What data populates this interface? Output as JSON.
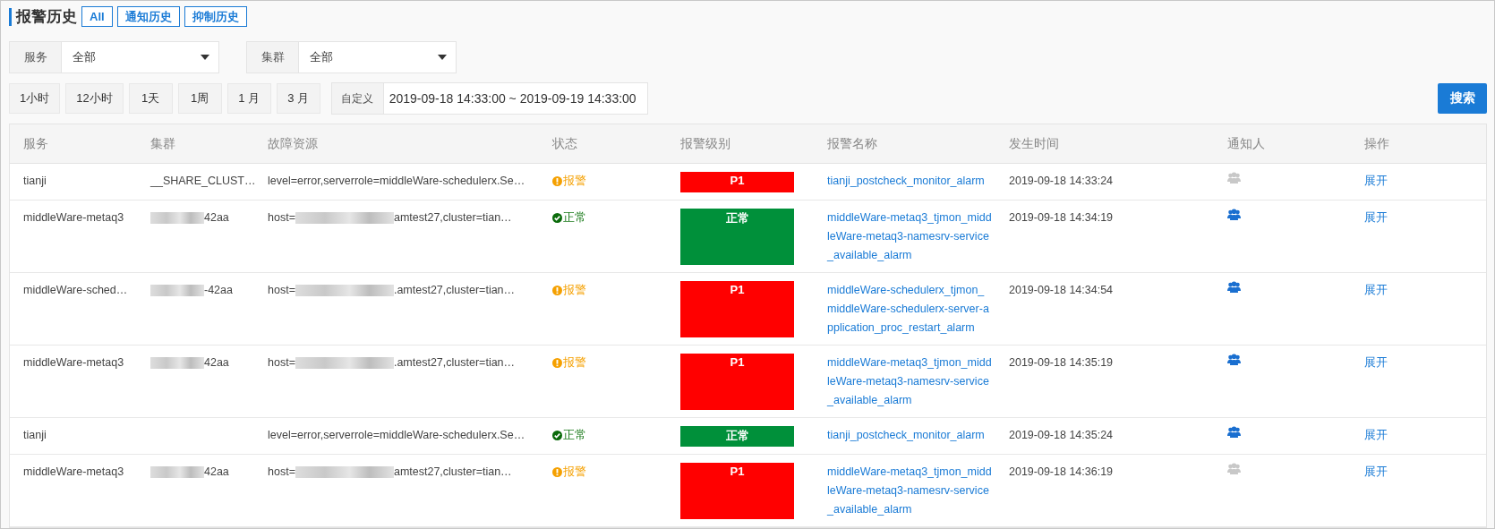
{
  "title": "报警历史",
  "history_tabs": [
    "All",
    "通知历史",
    "抑制历史"
  ],
  "filters": [
    {
      "label": "服务",
      "value": "全部"
    },
    {
      "label": "集群",
      "value": "全部"
    }
  ],
  "ranges": [
    "1小时",
    "12小时",
    "1天",
    "1周",
    "1 月",
    "3 月"
  ],
  "custom": {
    "label": "自定义",
    "value": "2019-09-18 14:33:00 ~ 2019-09-19 14:33:00"
  },
  "search_button": "搜索",
  "table": {
    "columns": [
      "服务",
      "集群",
      "故障资源",
      "状态",
      "报警级别",
      "报警名称",
      "发生时间",
      "通知人",
      "操作"
    ],
    "rows": [
      {
        "service": "tianji",
        "cluster": {
          "text": "__SHARE_CLUST…"
        },
        "resource": {
          "before": "level=error,serverrole=middleWare-schedulerx.Se…"
        },
        "status": {
          "kind": "alarm",
          "text": "报警"
        },
        "level": {
          "kind": "alarm",
          "text": "P1"
        },
        "name": "tianji_postcheck_monitor_alarm",
        "time": "2019-09-18 14:33:24",
        "notified": false,
        "action": "展开"
      },
      {
        "service": "middleWare-metaq3",
        "cluster": {
          "text": "42aa",
          "redacted": true
        },
        "resource": {
          "before": "host=",
          "after": "amtest27,cluster=tian…",
          "redacted": true
        },
        "status": {
          "kind": "normal",
          "text": "正常"
        },
        "level": {
          "kind": "normal",
          "text": "正常"
        },
        "name": "middleWare-metaq3_tjmon_middleWare-metaq3-namesrv-service_available_alarm",
        "time": "2019-09-18 14:34:19",
        "notified": true,
        "action": "展开"
      },
      {
        "service": "middleWare-sched…",
        "cluster": {
          "text": "-42aa",
          "redacted": true
        },
        "resource": {
          "before": "host=",
          "after": ".amtest27,cluster=tian…",
          "redacted": true
        },
        "status": {
          "kind": "alarm",
          "text": "报警"
        },
        "level": {
          "kind": "alarm",
          "text": "P1"
        },
        "name": "middleWare-schedulerx_tjmon_middleWare-schedulerx-server-application_proc_restart_alarm",
        "time": "2019-09-18 14:34:54",
        "notified": true,
        "action": "展开"
      },
      {
        "service": "middleWare-metaq3",
        "cluster": {
          "text": "42aa",
          "redacted": true
        },
        "resource": {
          "before": "host=",
          "after": ".amtest27,cluster=tian…",
          "redacted": true
        },
        "status": {
          "kind": "alarm",
          "text": "报警"
        },
        "level": {
          "kind": "alarm",
          "text": "P1"
        },
        "name": "middleWare-metaq3_tjmon_middleWare-metaq3-namesrv-service_available_alarm",
        "time": "2019-09-18 14:35:19",
        "notified": true,
        "action": "展开"
      },
      {
        "service": "tianji",
        "resource": {
          "before": "level=error,serverrole=middleWare-schedulerx.Se…"
        },
        "status": {
          "kind": "normal",
          "text": "正常"
        },
        "level": {
          "kind": "normal",
          "text": "正常"
        },
        "name": "tianji_postcheck_monitor_alarm",
        "time": "2019-09-18 14:35:24",
        "notified": true,
        "action": "展开"
      },
      {
        "service": "middleWare-metaq3",
        "cluster": {
          "text": "42aa",
          "redacted": true
        },
        "resource": {
          "before": "host=",
          "after": "amtest27,cluster=tian…",
          "redacted": true
        },
        "status": {
          "kind": "alarm",
          "text": "报警"
        },
        "level": {
          "kind": "alarm",
          "text": "P1"
        },
        "name": "middleWare-metaq3_tjmon_middleWare-metaq3-namesrv-service_available_alarm",
        "time": "2019-09-18 14:36:19",
        "notified": false,
        "action": "展开"
      }
    ]
  }
}
